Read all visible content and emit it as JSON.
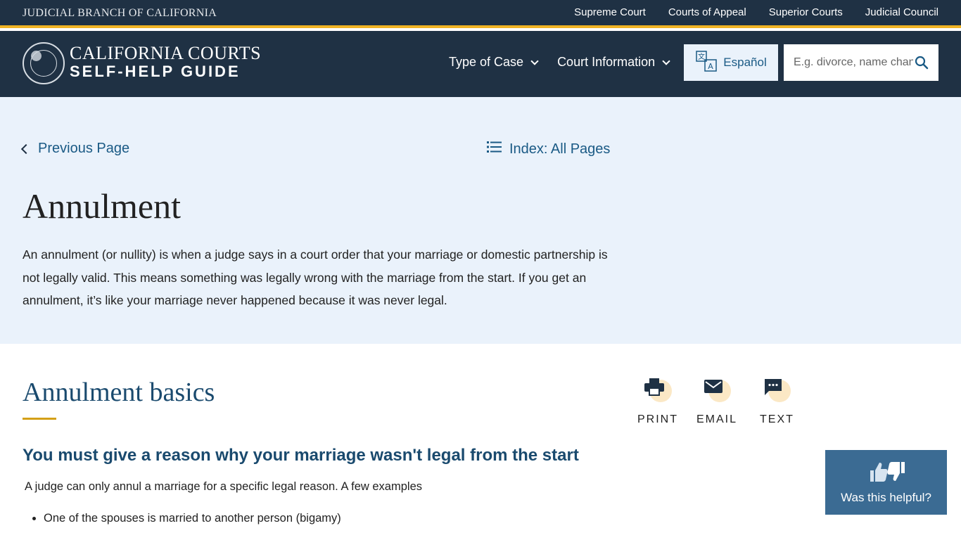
{
  "topbar": {
    "branch": "JUDICIAL BRANCH OF CALIFORNIA",
    "links": [
      "Supreme Court",
      "Courts of Appeal",
      "Superior Courts",
      "Judicial Council"
    ]
  },
  "header": {
    "logo_line1": "CALIFORNIA COURTS",
    "logo_line2": "SELF-HELP GUIDE",
    "nav": [
      "Type of Case",
      "Court Information"
    ],
    "espanol": "Español",
    "search_placeholder": "E.g. divorce, name change,"
  },
  "hero": {
    "previous_page": "Previous Page",
    "index": "Index: All Pages",
    "title": "Annulment",
    "intro": "An annulment (or nullity) is when a judge says in a court order that your marriage or domestic partnership is not legally valid. This means something was legally wrong with the marriage from the start. If you get an annulment, it’s like your marriage never happened because it was never legal."
  },
  "content": {
    "section_title": "Annulment basics",
    "subtitle": "You must give a reason why your marriage wasn't legal from the start",
    "paragraph": "A judge can only annul a marriage for a specific legal reason.  A few examples",
    "bullets": [
      "One of the spouses is married to another person (bigamy)"
    ]
  },
  "share": {
    "print": "PRINT",
    "email": "EMAIL",
    "text": "TEXT"
  },
  "feedback": {
    "label": "Was this helpful?"
  },
  "colors": {
    "navy": "#1f3144",
    "gold": "#f0b323",
    "link_blue": "#1a5a85",
    "hero_bg": "#eaf2fb",
    "feedback_bg": "#3b6b93"
  },
  "icons": [
    "seal-logo-icon",
    "chevron-down-icon",
    "translate-icon",
    "search-icon",
    "chevron-left-icon",
    "list-icon",
    "print-icon",
    "email-icon",
    "text-message-icon",
    "thumbs-up-down-icon"
  ]
}
